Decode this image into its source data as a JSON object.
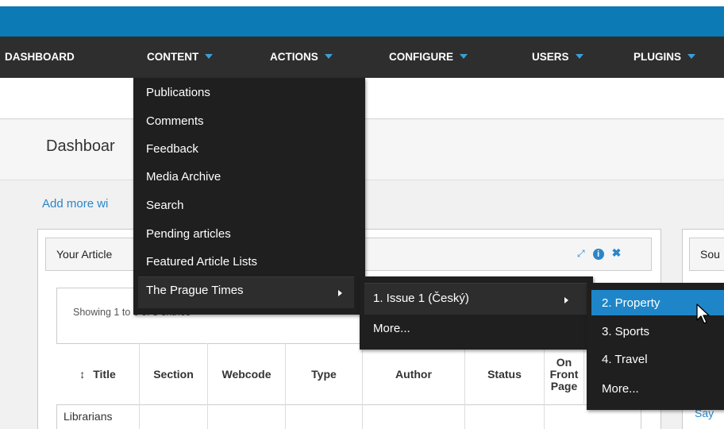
{
  "nav": {
    "dashboard": "DASHBOARD",
    "content": "CONTENT",
    "actions": "ACTIONS",
    "configure": "CONFIGURE",
    "users": "USERS",
    "plugins": "PLUGINS"
  },
  "page": {
    "title": "Dashboar",
    "add_widgets": "Add more wi"
  },
  "panel": {
    "title": "Your Article",
    "icons": [
      "expand-icon",
      "info-icon",
      "close-icon"
    ],
    "showing": "Showing 1 to 3 of 3 entries"
  },
  "panel2": {
    "title": "Sou",
    "link": "Say"
  },
  "table": {
    "headers": [
      "Title",
      "Section",
      "Webcode",
      "Type",
      "Author",
      "Status",
      "On Front Page"
    ],
    "first_cell": "Librarians"
  },
  "content_menu": {
    "items": [
      "Publications",
      "Comments",
      "Feedback",
      "Media Archive",
      "Search",
      "Pending articles",
      "Featured Article Lists",
      "The Prague Times"
    ]
  },
  "issues_menu": {
    "items": [
      "1. Issue 1 (Český)",
      "More..."
    ]
  },
  "sections_menu": {
    "items": [
      "2. Property",
      "3. Sports",
      "4. Travel",
      "More..."
    ],
    "selected": "2. Property"
  },
  "colors": {
    "brand_blue": "#0b7ab5",
    "nav_dark": "#2e2e2e",
    "selection": "#1e86c8",
    "link": "#2a86c9"
  }
}
